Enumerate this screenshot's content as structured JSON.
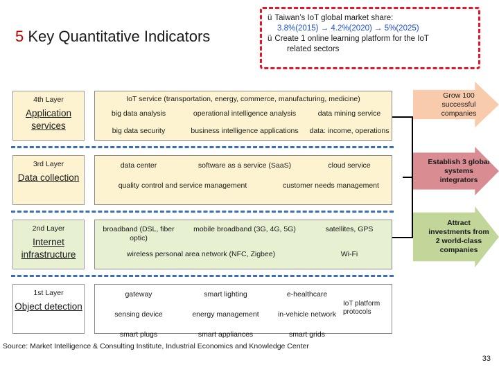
{
  "title": {
    "accent": "5",
    "rest": " Key Quantitative Indicators"
  },
  "callout": {
    "line1_tick": "ü",
    "line1": "Taiwan’s IoT global market share:",
    "line2_plain_a": "3.8%(2015)",
    "line2_arrow_a": " → ",
    "line2_plain_b": "4.2%(2020)",
    "line2_arrow_b": " → ",
    "line2_plain_c": "5%(2025)",
    "line3_tick": "ü",
    "line3": "Create 1 online learning platform for the IoT",
    "line4": "related sectors",
    "blue_color": "#1f4fd8",
    "border_color": "#e8152a"
  },
  "layers": [
    {
      "name": "4th Layer",
      "title": "Application services",
      "head": "IoT service (transportation, energy, commerce, manufacturing, medicine)",
      "row1": [
        "big data analysis",
        "operational intelligence analysis",
        "data mining service"
      ],
      "row2": [
        "big data security",
        "business intelligence applications",
        "data: income, operations"
      ],
      "bg": "#fdf3d0"
    },
    {
      "name": "3rd Layer",
      "title": "Data collection",
      "row1": [
        "data center",
        "software as a service (SaaS)",
        "cloud service"
      ],
      "row2": [
        "quality control and service management",
        "customer needs management"
      ],
      "bg": "#fdf3d0"
    },
    {
      "name": "2nd Layer",
      "title": "Internet infrastructure",
      "row1": [
        "broadband (DSL, fiber optic)",
        "mobile broadband (3G, 4G, 5G)",
        "satellites, GPS"
      ],
      "row2": [
        "wireless personal area network (NFC, Zigbee)",
        "Wi-Fi"
      ],
      "bg": "#e8f0d2"
    },
    {
      "name": "1st Layer",
      "title": "Object detection",
      "row1": [
        "gateway",
        "smart lighting",
        "e-healthcare"
      ],
      "row2": [
        "sensing device",
        "energy management",
        "in-vehicle network"
      ],
      "row3": [
        "smart plugs",
        "smart appliances",
        "smart grids"
      ],
      "side": "IoT platform protocols",
      "bg": "#ffffff"
    }
  ],
  "arrows": [
    {
      "text": "Grow 100 successful companies",
      "color": "#f8cbad"
    },
    {
      "text": "Establish 3 global systems integrators",
      "color": "#d98d92"
    },
    {
      "text": "Attract investments from 2 world-class companies",
      "color": "#c2d69a"
    }
  ],
  "source": "Source: Market Intelligence & Consulting Institute, Industrial Economics and Knowledge Center",
  "page_number": "33"
}
